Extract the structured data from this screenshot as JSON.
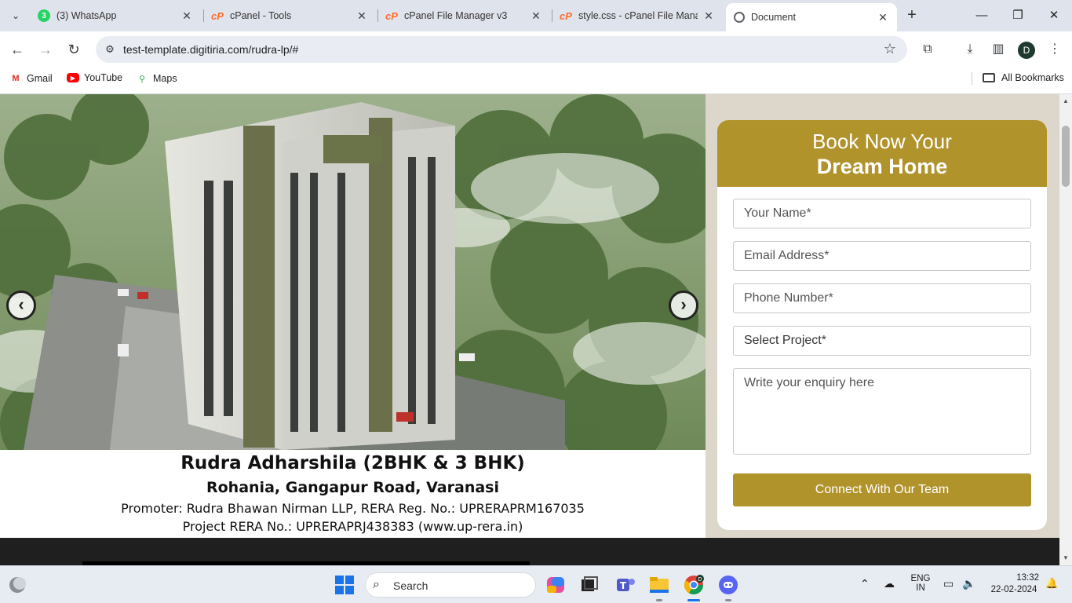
{
  "browser": {
    "tabs": [
      {
        "title": "(3) WhatsApp",
        "icon": "whatsapp-icon",
        "badge": "3"
      },
      {
        "title": "cPanel - Tools",
        "icon": "cpanel-icon"
      },
      {
        "title": "cPanel File Manager v3",
        "icon": "cpanel-icon"
      },
      {
        "title": "style.css - cPanel File Manag",
        "icon": "cpanel-icon"
      },
      {
        "title": "Document",
        "icon": "globe-icon",
        "active": true
      }
    ],
    "url": "test-template.digitiria.com/rudra-lp/#",
    "profile_initial": "D",
    "bookmarks": [
      {
        "label": "Gmail",
        "icon": "gmail-icon"
      },
      {
        "label": "YouTube",
        "icon": "youtube-icon"
      },
      {
        "label": "Maps",
        "icon": "maps-icon"
      }
    ],
    "all_bookmarks_label": "All Bookmarks"
  },
  "hero": {
    "title": "Rudra Adharshila (2BHK & 3 BHK)",
    "location": "Rohania, Gangapur Road, Varanasi",
    "promoter": "Promoter: Rudra Bhawan Nirman LLP, RERA Reg. No.: UPRERAPRM167035",
    "rera": "Project RERA No.: UPRERAPRJ438383 (www.up-rera.in)",
    "prev_symbol": "‹",
    "next_symbol": "›"
  },
  "form": {
    "heading_line1": "Book Now Your",
    "heading_line2": "Dream Home",
    "name_placeholder": "Your Name*",
    "email_placeholder": "Email Address*",
    "phone_placeholder": "Phone Number*",
    "project_select": "Select Project*",
    "enquiry_placeholder": "Write your enquiry here",
    "submit_label": "Connect With Our Team",
    "accent_color": "#b1932c"
  },
  "taskbar": {
    "search_label": "Search",
    "lang_line1": "ENG",
    "lang_line2": "IN",
    "time": "13:32",
    "date": "22-02-2024"
  }
}
